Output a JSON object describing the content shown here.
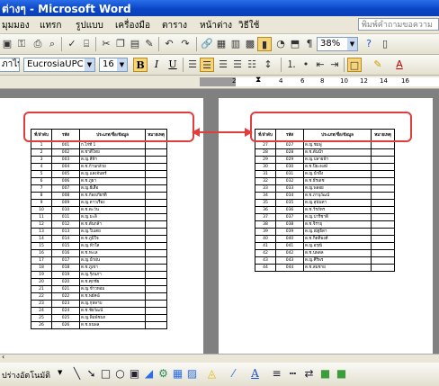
{
  "window": {
    "title": "ต่างๆ - Microsoft Word"
  },
  "menu": {
    "items": [
      "มุมมอง",
      "แทรก",
      "รูปแบบ",
      "เครื่องมือ",
      "ตาราง",
      "หน้าต่าง",
      "วิธีใช้"
    ],
    "help_placeholder": "พิมพ์คำถามขอความ"
  },
  "toolbar": {
    "zoom": "38%",
    "style": "ภาไท",
    "font": "EucrosiaUPC",
    "size": "16",
    "bold": "B",
    "italic": "I",
    "underline": "U",
    "font_color_label": "A"
  },
  "ruler": {
    "labels": [
      "2",
      "4",
      "6",
      "8",
      "10",
      "12",
      "14",
      "16"
    ]
  },
  "table": {
    "headers": [
      "ที่/ลำดับ",
      "รหัส",
      "ประเภท/ชื่อ/ข้อมูล",
      "หมายเหตุ"
    ],
    "page1_rows": [
      [
        "1",
        "001",
        "ก.ไก่ที่ 1"
      ],
      [
        "2",
        "002",
        "ด.ชาติไทย"
      ],
      [
        "3",
        "003",
        "ด.ญ.สีฟ้า"
      ],
      [
        "4",
        "004",
        "ด.ช.ก้านกล้วย"
      ],
      [
        "5",
        "005",
        "ด.ญ.แสงจันทร์"
      ],
      [
        "6",
        "006",
        "ด.ช.ภูผา"
      ],
      [
        "7",
        "007",
        "ด.ญ.ผีเสื้อ"
      ],
      [
        "8",
        "008",
        "ด.ช.ก้องเกียรติ"
      ],
      [
        "9",
        "009",
        "ด.ญ.ดาวเรือง"
      ],
      [
        "10",
        "010",
        "ด.ช.ตะวัน"
      ],
      [
        "11",
        "011",
        "ด.ญ.มะลิ"
      ],
      [
        "12",
        "012",
        "ด.ช.ต้นกล้า"
      ],
      [
        "13",
        "013",
        "ด.ญ.ใบเตย"
      ],
      [
        "14",
        "014",
        "ด.ช.ภูมิใจ"
      ],
      [
        "15",
        "015",
        "ด.ญ.ฟ้าใส"
      ],
      [
        "16",
        "016",
        "ด.ช.ทะเล"
      ],
      [
        "17",
        "017",
        "ด.ญ.น้ำฝน"
      ],
      [
        "18",
        "018",
        "ด.ช.ภูเขา"
      ],
      [
        "19",
        "019",
        "ด.ญ.รุ้งนภา"
      ],
      [
        "20",
        "020",
        "ด.ช.ศุภชัย"
      ],
      [
        "21",
        "021",
        "ด.ญ.ข้าวหอม"
      ],
      [
        "22",
        "022",
        "ด.ช.พยัคฆ์"
      ],
      [
        "23",
        "023",
        "ด.ญ.กุหลาบ"
      ],
      [
        "24",
        "024",
        "ด.ช.ชัยวัฒน์"
      ],
      [
        "25",
        "025",
        "ด.ญ.พิมพ์ชนก"
      ],
      [
        "26",
        "026",
        "ด.ช.ธนพล"
      ]
    ],
    "page2_rows": [
      [
        "27",
        "027",
        "ด.ญ.ชมพู่"
      ],
      [
        "28",
        "028",
        "ด.ช.ต้นน้ำ"
      ],
      [
        "29",
        "029",
        "ด.ญ.ปลายฟ้า"
      ],
      [
        "30",
        "030",
        "ด.ช.ปิยะพงษ์"
      ],
      [
        "31",
        "031",
        "ด.ญ.น้ำผึ้ง"
      ],
      [
        "32",
        "032",
        "ด.ช.ธีรเดช"
      ],
      [
        "33",
        "033",
        "ด.ญ.พลอย"
      ],
      [
        "34",
        "034",
        "ด.ช.ภานุวัฒน์"
      ],
      [
        "35",
        "035",
        "ด.ญ.สุนันทา"
      ],
      [
        "36",
        "036",
        "ด.ช.วีรภัทร"
      ],
      [
        "37",
        "037",
        "ด.ญ.ปาริชาติ"
      ],
      [
        "38",
        "038",
        "ด.ช.จิรายุ"
      ],
      [
        "39",
        "039",
        "ด.ญ.ณัฐธิดา"
      ],
      [
        "40",
        "040",
        "ด.ช.กิตติพงศ์"
      ],
      [
        "41",
        "041",
        "ด.ญ.อรุณี"
      ],
      [
        "42",
        "042",
        "ด.ช.นพดล"
      ],
      [
        "43",
        "043",
        "ด.ญ.ศิริพร"
      ],
      [
        "44",
        "044",
        "ด.ช.สมชาย"
      ]
    ]
  },
  "statusbar": {
    "draw_label": "ปร่างอัตโนมัติ"
  },
  "colors": {
    "title_bar": "#0a46c8",
    "highlight": "#e23d3d",
    "doc_bg": "#808080"
  }
}
